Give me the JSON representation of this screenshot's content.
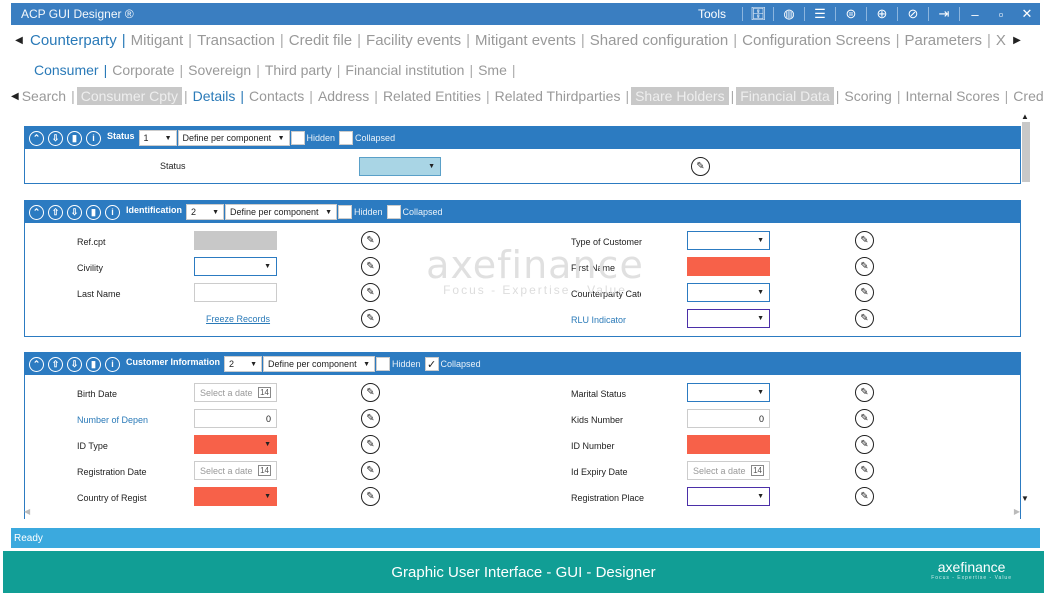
{
  "app_title": "ACP GUI Designer ®",
  "toolbar": {
    "tools_label": "Tools",
    "icons": [
      "database-icon",
      "globe-icon",
      "list-icon",
      "circle-menu-icon",
      "plus-icon",
      "trash-icon",
      "exit-icon"
    ],
    "window_controls": [
      "–",
      "▫",
      "✕"
    ]
  },
  "tabs_main": [
    "Counterparty",
    "Mitigant",
    "Transaction",
    "Credit file",
    "Facility events",
    "Mitigant events",
    "Shared configuration",
    "Configuration Screens",
    "Parameters",
    "X"
  ],
  "tabs_sub": [
    "Consumer",
    "Corporate",
    "Sovereign",
    "Third party",
    "Financial institution",
    "Sme"
  ],
  "tabs_detail": [
    "Search",
    "Consumer Cpty",
    "Details",
    "Contacts",
    "Address",
    "Related Entities",
    "Related Thirdparties",
    "Share Holders",
    "Financial Data",
    "Scoring",
    "Internal Scores",
    "Cred"
  ],
  "panels": {
    "status": {
      "title": "Status",
      "order": "1",
      "mode": "Define per component",
      "hidden_label": "Hidden",
      "collapsed_label": "Collapsed",
      "field_label": "Status"
    },
    "identification": {
      "title": "Identification",
      "order": "2",
      "mode": "Define per component",
      "hidden_label": "Hidden",
      "collapsed_label": "Collapsed",
      "left_labels": [
        "Ref.cpt",
        "Civility",
        "Last Name"
      ],
      "freeze_link": "Freeze Records",
      "right_labels": [
        "Type of Customer",
        "First Name",
        "Counterparty Cate",
        "RLU Indicator"
      ]
    },
    "customer": {
      "title": "Customer Information",
      "order": "2",
      "mode": "Define per component",
      "hidden_label": "Hidden",
      "collapsed_label": "Collapsed",
      "collapsed_checked": "✓",
      "left_labels": [
        "Birth Date",
        "Number of Depen",
        "ID Type",
        "Registration Date",
        "Country of Regist"
      ],
      "right_labels": [
        "Marital Status",
        "Kids Number",
        "ID Number",
        "Id Expiry Date",
        "Registration Place"
      ],
      "date_placeholder": "Select a date",
      "dependents_value": "0",
      "kids_value": "0"
    }
  },
  "watermark": {
    "name": "axefinance",
    "tagline": "Focus - Expertise - Value"
  },
  "status_text": "Ready",
  "footer": {
    "title": "Graphic User Interface - GUI - Designer",
    "logo": "axefinance",
    "logo_tag": "Focus - Expertise - Value"
  }
}
